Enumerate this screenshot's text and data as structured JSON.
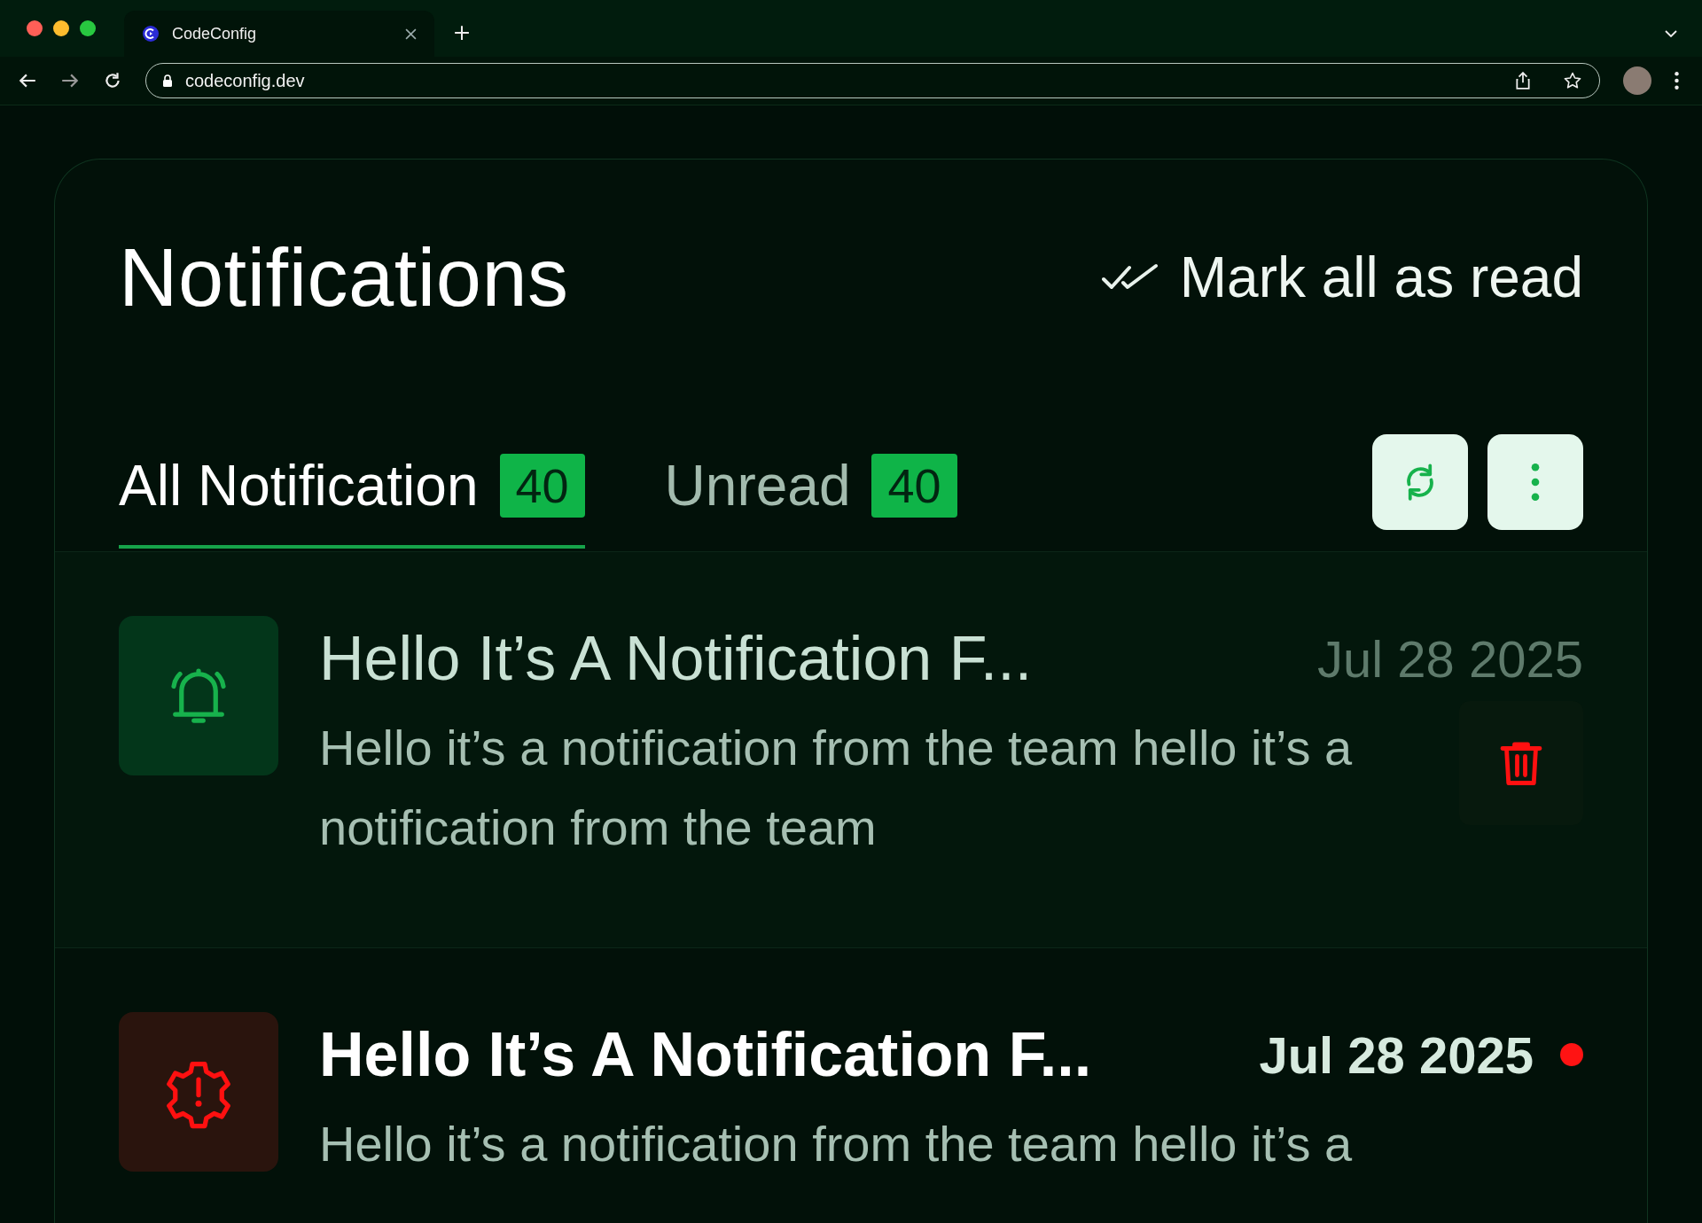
{
  "browser": {
    "tab_title": "CodeConfig",
    "url": "codeconfig.dev"
  },
  "header": {
    "title": "Notifications",
    "mark_all": "Mark all as read"
  },
  "tabs": [
    {
      "label": "All Notification",
      "count": "40",
      "selected": true
    },
    {
      "label": "Unread",
      "count": "40",
      "selected": false
    }
  ],
  "notifications": [
    {
      "kind": "bell",
      "title": "Hello It’s A Notification F...",
      "date": "Jul 28 2025",
      "body": "Hello it’s a notification from the team hello it’s a notification from the team",
      "unread": false,
      "hovered": true
    },
    {
      "kind": "alert",
      "title": "Hello It’s A Notification F...",
      "date": "Jul 28 2025",
      "body": "Hello it’s a notification from the team hello it’s a",
      "unread": true,
      "hovered": false
    }
  ]
}
